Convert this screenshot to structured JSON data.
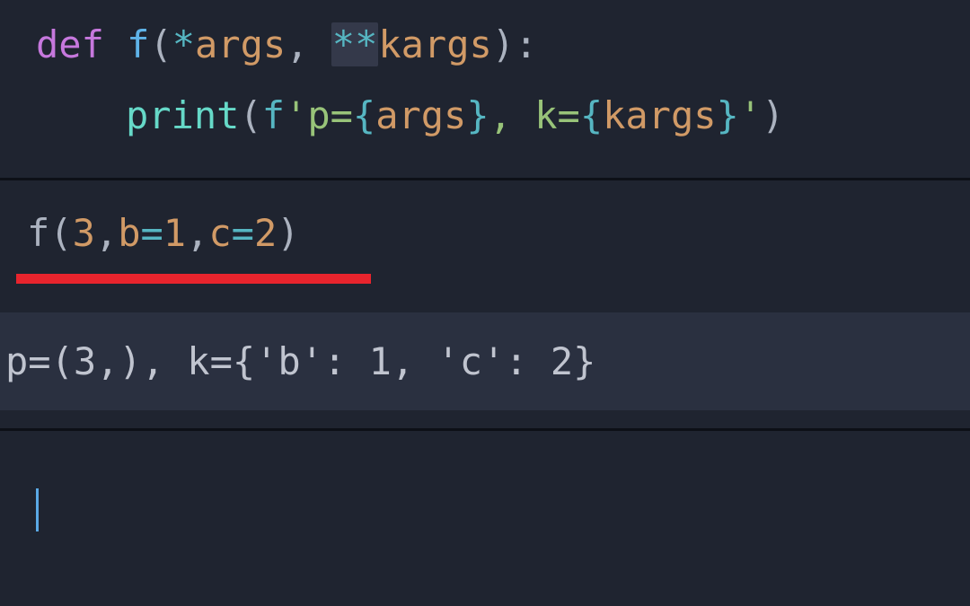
{
  "cell1": {
    "line1": {
      "kw_def": "def",
      "sp1": " ",
      "fn_name": "f",
      "paren_open": "(",
      "star": "*",
      "args": "args",
      "comma_sp": ", ",
      "starstar": "**",
      "kargs": "kargs",
      "paren_close": ")",
      "colon": ":"
    },
    "line2": {
      "print": "print",
      "paren_open": "(",
      "fprefix": "f",
      "q1": "'",
      "lit_p": "p=",
      "brace_o1": "{",
      "args": "args",
      "brace_c1": "}",
      "lit_mid": ", k=",
      "brace_o2": "{",
      "kargs": "kargs",
      "brace_c2": "}",
      "q2": "'",
      "paren_close": ")"
    }
  },
  "cell2": {
    "fn": "f",
    "popen": "(",
    "n3": "3",
    "c1": ",",
    "b": "b",
    "eq1": "=",
    "n1": "1",
    "c2": ",",
    "c": "c",
    "eq2": "=",
    "n2": "2",
    "pclose": ")"
  },
  "output": {
    "text": "p=(3,), k={'b': 1, 'c': 2}"
  }
}
